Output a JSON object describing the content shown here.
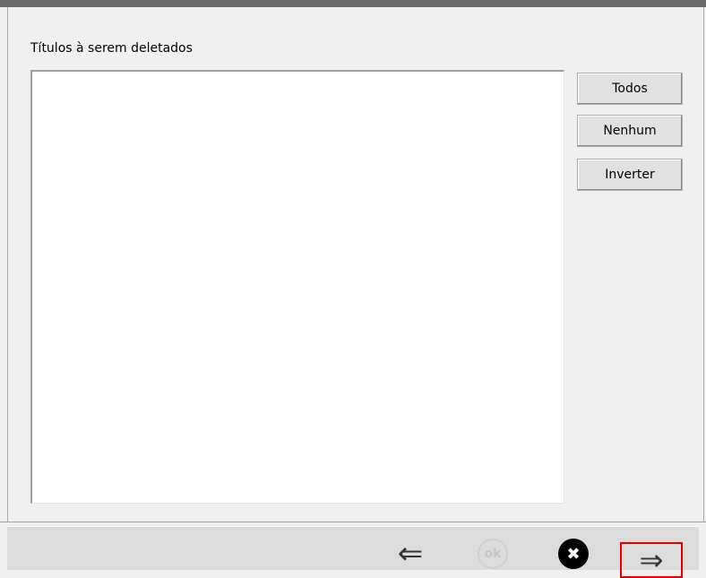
{
  "dialog": {
    "list_label": "Títulos à serem deletados",
    "list_items": []
  },
  "buttons": {
    "all": "Todos",
    "none": "Nenhum",
    "invert": "Inverter"
  },
  "footer": {
    "ok_label": "ok",
    "icons": {
      "back": "back-arrow-icon",
      "ok": "ok-icon",
      "cancel": "cancel-icon",
      "next": "next-arrow-icon"
    },
    "highlight_color": "#e60000"
  }
}
